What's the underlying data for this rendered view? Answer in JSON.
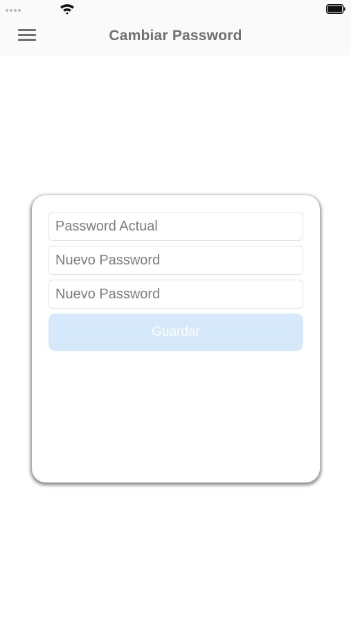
{
  "status_bar": {
    "signal_icon": "signal-dots-icon",
    "wifi_icon": "wifi-icon",
    "battery_icon": "battery-icon"
  },
  "nav": {
    "title": "Cambiar Password",
    "menu_icon": "hamburger-menu-icon"
  },
  "form": {
    "current_password": {
      "placeholder": "Password Actual",
      "value": ""
    },
    "new_password": {
      "placeholder": "Nuevo Password",
      "value": ""
    },
    "confirm_password": {
      "placeholder": "Nuevo Password",
      "value": ""
    },
    "save_label": "Guardar"
  },
  "colors": {
    "nav_background": "#fafafa",
    "title_text": "#717171",
    "button_background": "#d6e9fb",
    "button_text": "#ffffff"
  }
}
